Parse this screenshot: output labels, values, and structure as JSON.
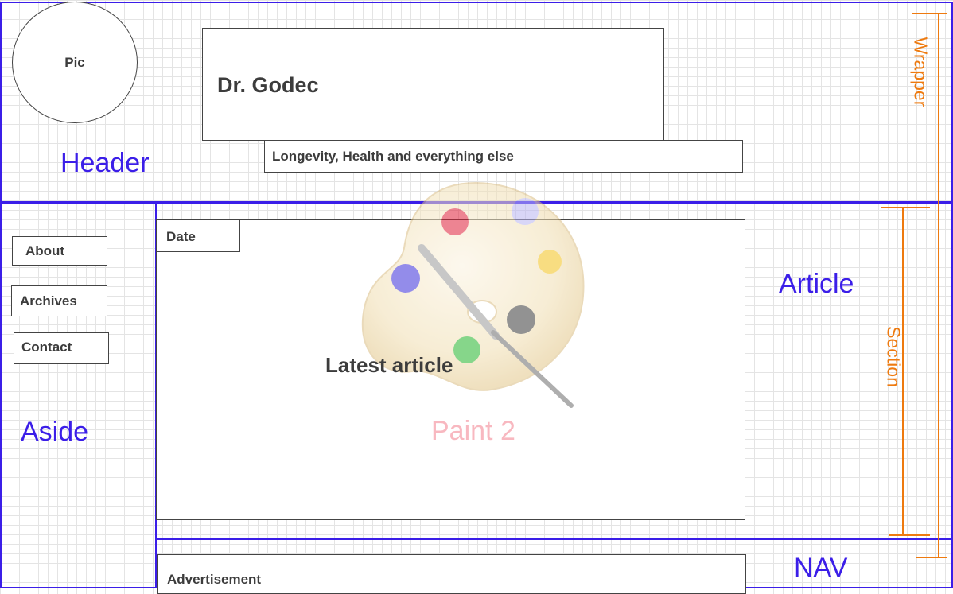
{
  "header": {
    "pic_label": "Pic",
    "title": "Dr. Godec",
    "subtitle": "Longevity, Health and everything else",
    "region_label": "Header"
  },
  "aside": {
    "region_label": "Aside",
    "menu": [
      {
        "label": "About"
      },
      {
        "label": "Archives"
      },
      {
        "label": "Contact"
      }
    ]
  },
  "article": {
    "date_label": "Date",
    "heading": "Latest article",
    "region_label": "Article",
    "watermark_text": "Paint 2"
  },
  "nav": {
    "region_label": "NAV",
    "ad_label": "Advertisement"
  },
  "annotations": {
    "wrapper": "Wrapper",
    "section": "Section"
  },
  "colors": {
    "region_border": "#3b1ee8",
    "annotation": "#ee7a0f",
    "watermark": "#f8b8c0"
  },
  "icons": [
    "paint-palette-icon"
  ]
}
